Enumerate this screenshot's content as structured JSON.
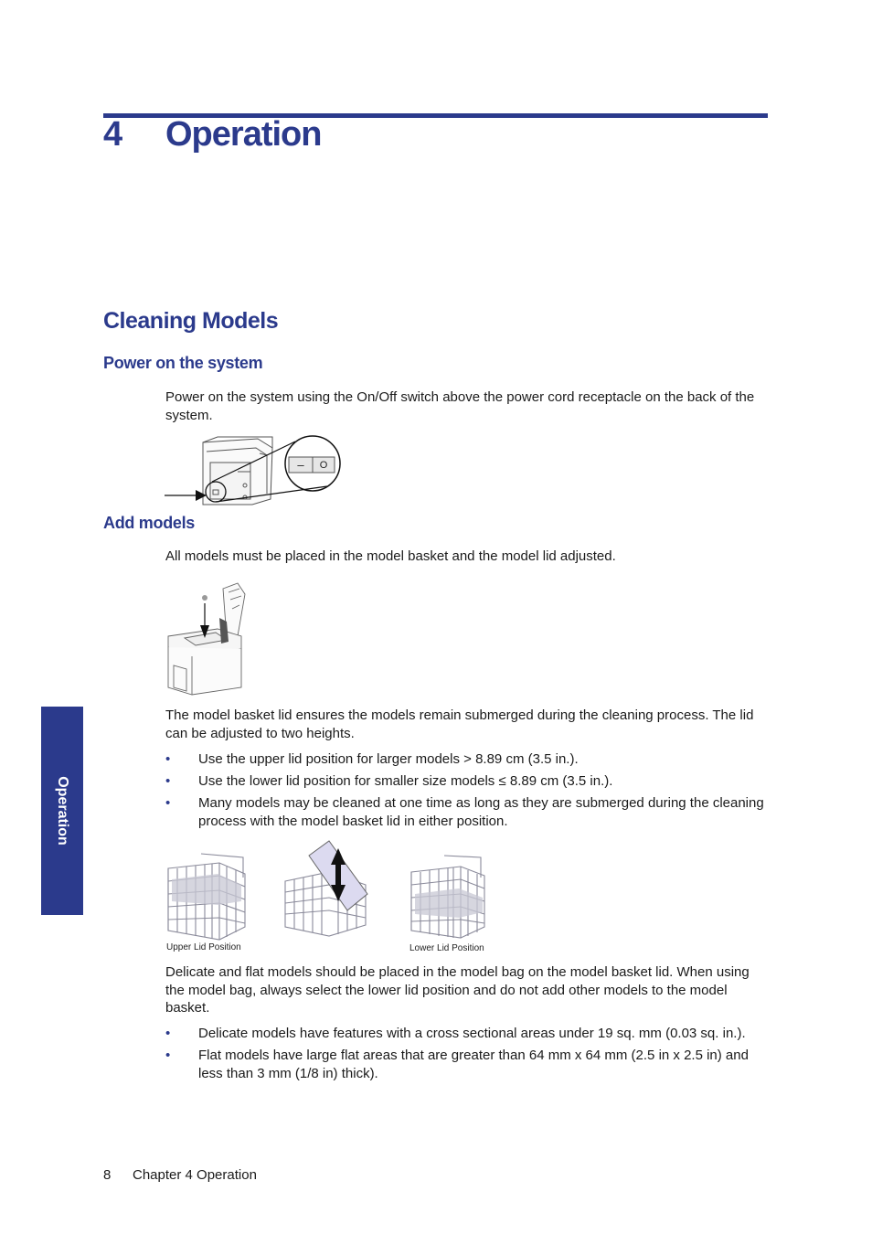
{
  "chapter": {
    "number": "4",
    "title": "Operation"
  },
  "section": {
    "title": "Cleaning Models"
  },
  "power_on": {
    "heading": "Power on the system",
    "text": "Power on the system using the On/Off switch above the power cord receptacle on the back of the system.",
    "figure": {
      "switch_on_symbol": "–",
      "switch_off_symbol": "O"
    }
  },
  "add_models": {
    "heading": "Add models",
    "text": "All models must be placed in the model basket and the model lid adjusted.",
    "lid_paragraph": "The model basket lid ensures the models remain submerged during the cleaning process. The lid can be adjusted to two heights.",
    "bullets": [
      "Use the upper lid position for larger models > 8.89 cm (3.5 in.).",
      "Use the lower lid position for smaller size models ≤ 8.89 cm (3.5 in.).",
      "Many models may be cleaned at one time as long as they are submerged during the cleaning process with the model basket lid in either position."
    ],
    "figure_captions": {
      "upper": "Upper Lid Position",
      "lower": "Lower Lid Position"
    },
    "bag_paragraph": "Delicate and flat models should be placed in the model bag on the model basket lid. When using the model bag, always select the lower lid position and do not add other models to the model basket.",
    "bag_bullets": [
      "Delicate models have features with a cross sectional areas under 19 sq. mm (0.03 sq. in.).",
      "Flat models have large flat areas that are greater than 64 mm x 64 mm (2.5 in x 2.5 in) and less than 3 mm (1/8 in) thick)."
    ]
  },
  "side_tab": {
    "label": "Operation"
  },
  "footer": {
    "page_number": "8",
    "chapter_label": "Chapter 4 Operation"
  },
  "colors": {
    "accent": "#2b3a8c"
  },
  "bullet_glyph": "•"
}
